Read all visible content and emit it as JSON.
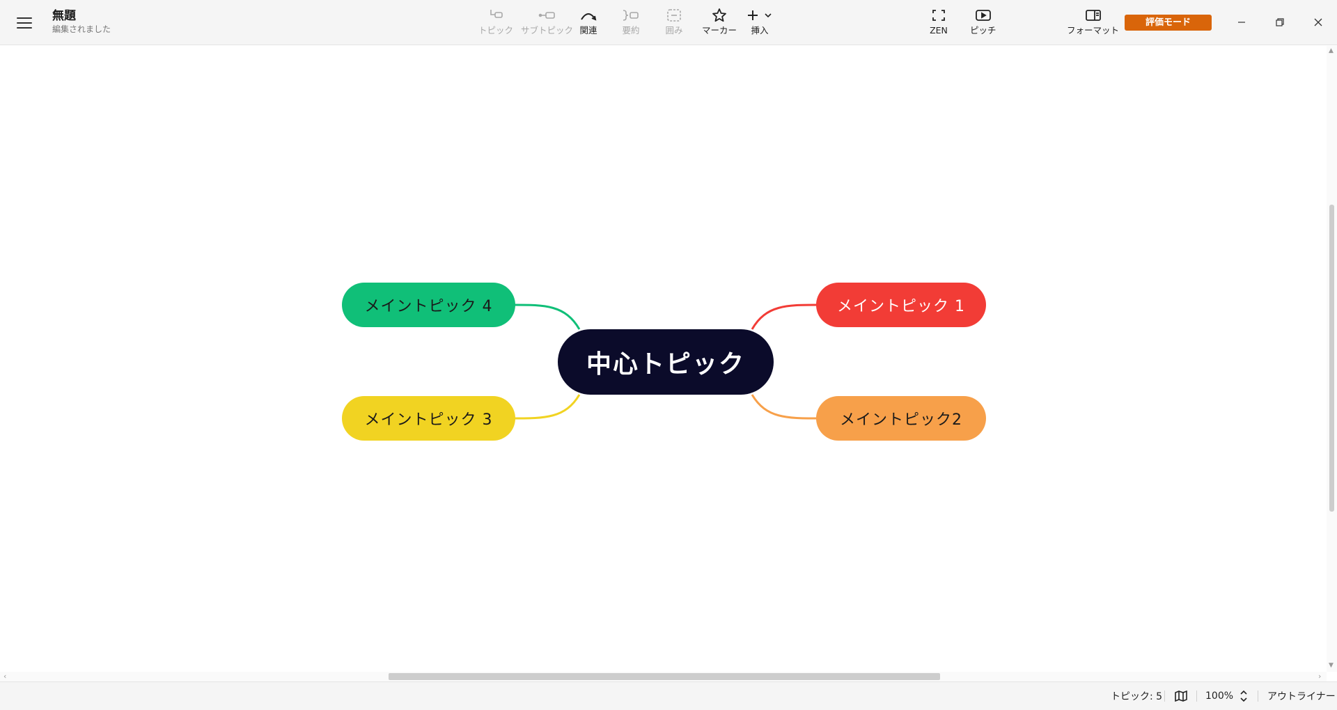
{
  "header": {
    "title": "無題",
    "status": "編集されました"
  },
  "toolbar": {
    "items": [
      {
        "label": "トピック",
        "icon": "topic-icon",
        "enabled": false
      },
      {
        "label": "サブトピック",
        "icon": "subtopic-icon",
        "enabled": false
      },
      {
        "label": "関連",
        "icon": "relationship-icon",
        "enabled": true
      },
      {
        "label": "要約",
        "icon": "summary-icon",
        "enabled": false
      },
      {
        "label": "囲み",
        "icon": "boundary-icon",
        "enabled": false
      },
      {
        "label": "マーカー",
        "icon": "star-icon",
        "enabled": true
      },
      {
        "label": "挿入",
        "icon": "plus-icon",
        "enabled": true
      }
    ],
    "zen_label": "ZEN",
    "pitch_label": "ピッチ",
    "format_label": "フォーマット",
    "eval_mode_label": "評価モード"
  },
  "mindmap": {
    "central": "中心トピック",
    "topics": [
      {
        "label": "メイントピック 1",
        "color": "#f23c36"
      },
      {
        "label": "メイントピック2",
        "color": "#f7a04a"
      },
      {
        "label": "メイントピック 3",
        "color": "#f1d322"
      },
      {
        "label": "メイントピック 4",
        "color": "#10bf78"
      }
    ],
    "central_color": "#0b0b2a"
  },
  "statusbar": {
    "topic_count": "トピック: 5",
    "zoom": "100%",
    "outliner_label": "アウトライナー"
  },
  "colors": {
    "accent": "#d9650a"
  }
}
